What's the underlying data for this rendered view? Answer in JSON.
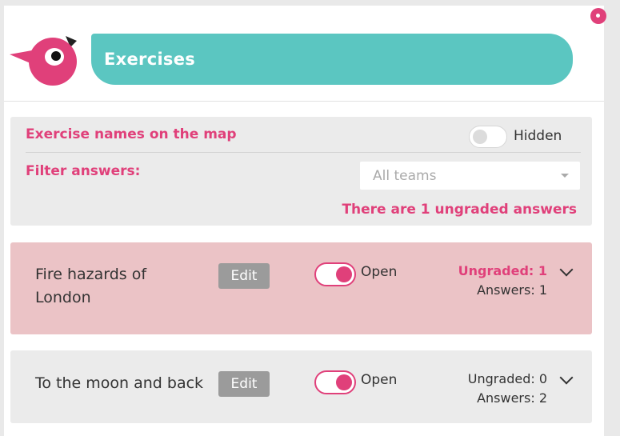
{
  "header": {
    "title": "Exercises"
  },
  "settings": {
    "map_names_label": "Exercise names on the map",
    "map_names_state": "Hidden",
    "filter_label": "Filter answers:",
    "team_filter_value": "All teams",
    "ungraded_notice": "There are 1 ungraded answers"
  },
  "exercises": [
    {
      "name": "Fire hazards of London",
      "edit_label": "Edit",
      "status_label": "Open",
      "ungraded": "Ungraded: 1",
      "answers": "Answers: 1"
    },
    {
      "name": "To the moon and back",
      "edit_label": "Edit",
      "status_label": "Open",
      "ungraded": "Ungraded: 0",
      "answers": "Answers: 2"
    }
  ],
  "colors": {
    "brand_pink": "#e0407a",
    "header_teal": "#5bc6c1",
    "highlight_card": "#ebc3c6"
  }
}
